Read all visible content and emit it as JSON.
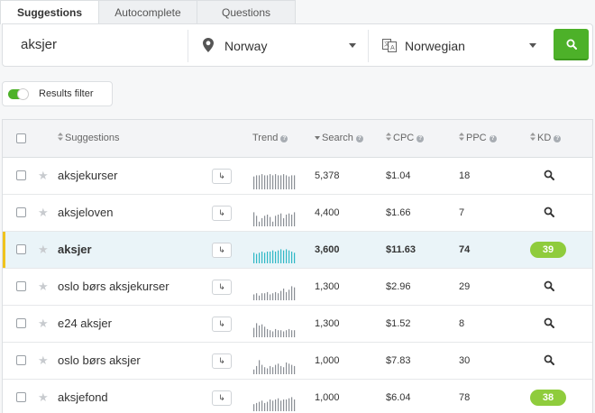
{
  "tabs": [
    {
      "label": "Suggestions",
      "active": true
    },
    {
      "label": "Autocomplete",
      "active": false
    },
    {
      "label": "Questions",
      "active": false
    }
  ],
  "search": {
    "keyword": "aksjer",
    "location": "Norway",
    "language": "Norwegian",
    "button_icon": "search-icon"
  },
  "filter": {
    "label": "Results filter",
    "enabled": true
  },
  "table": {
    "headers": {
      "suggestions": "Suggestions",
      "trend": "Trend",
      "search": "Search",
      "cpc": "CPC",
      "ppc": "PPC",
      "kd": "KD"
    },
    "rows": [
      {
        "keyword": "aksjekurser",
        "search": "5,378",
        "cpc": "$1.04",
        "ppc": "18",
        "kd": null,
        "trend": [
          0.55,
          0.6,
          0.6,
          0.65,
          0.6,
          0.6,
          0.65,
          0.6,
          0.65,
          0.6,
          0.6,
          0.65,
          0.6,
          0.55,
          0.6,
          0.6
        ]
      },
      {
        "keyword": "aksjeloven",
        "search": "4,400",
        "cpc": "$1.66",
        "ppc": "7",
        "kd": null,
        "trend": [
          0.6,
          0.45,
          0.2,
          0.35,
          0.45,
          0.5,
          0.4,
          0.2,
          0.45,
          0.5,
          0.55,
          0.35,
          0.5,
          0.55,
          0.5,
          0.6
        ]
      },
      {
        "keyword": "aksjer",
        "search": "3,600",
        "cpc": "$11.63",
        "ppc": "74",
        "kd": "39",
        "trend": [
          0.45,
          0.4,
          0.45,
          0.5,
          0.45,
          0.5,
          0.5,
          0.55,
          0.5,
          0.55,
          0.6,
          0.55,
          0.6,
          0.55,
          0.5,
          0.45
        ],
        "highlight": true
      },
      {
        "keyword": "oslo børs aksjekurser",
        "search": "1,300",
        "cpc": "$2.96",
        "ppc": "29",
        "kd": null,
        "trend": [
          0.25,
          0.3,
          0.2,
          0.3,
          0.3,
          0.35,
          0.25,
          0.3,
          0.35,
          0.3,
          0.4,
          0.5,
          0.35,
          0.45,
          0.6,
          0.55
        ]
      },
      {
        "keyword": "e24 aksjer",
        "search": "1,300",
        "cpc": "$1.52",
        "ppc": "8",
        "kd": null,
        "trend": [
          0.4,
          0.6,
          0.5,
          0.55,
          0.45,
          0.35,
          0.3,
          0.25,
          0.35,
          0.3,
          0.3,
          0.25,
          0.3,
          0.35,
          0.3,
          0.3
        ]
      },
      {
        "keyword": "oslo børs aksjer",
        "search": "1,000",
        "cpc": "$7.83",
        "ppc": "30",
        "kd": null,
        "trend": [
          0.2,
          0.35,
          0.6,
          0.4,
          0.3,
          0.25,
          0.35,
          0.3,
          0.4,
          0.45,
          0.35,
          0.3,
          0.5,
          0.45,
          0.4,
          0.35
        ]
      },
      {
        "keyword": "aksjefond",
        "search": "1,000",
        "cpc": "$6.04",
        "ppc": "78",
        "kd": "38",
        "trend": [
          0.3,
          0.35,
          0.4,
          0.45,
          0.35,
          0.4,
          0.5,
          0.45,
          0.5,
          0.55,
          0.45,
          0.5,
          0.5,
          0.55,
          0.6,
          0.5
        ]
      }
    ]
  },
  "colors": {
    "accent_green": "#4db129",
    "kd_badge": "#8fcc3c",
    "trend_bar": "#8a8f95",
    "trend_bar_highlight": "#2fb8c6",
    "highlight_marker": "#f0c31d"
  }
}
